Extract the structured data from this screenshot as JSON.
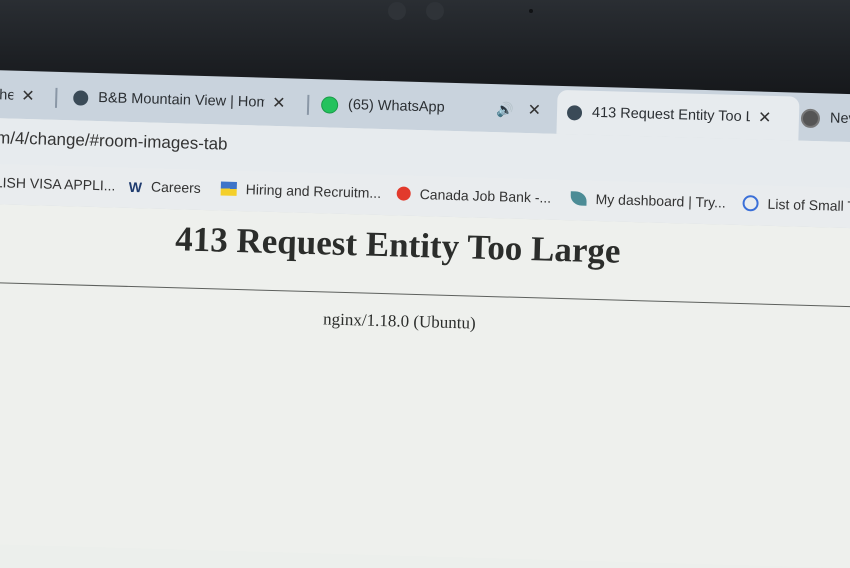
{
  "tabs": [
    {
      "title": "hea",
      "active": false,
      "icon": "none"
    },
    {
      "title": "B&B Mountain View | Hom",
      "active": false,
      "icon": "globe-icon"
    },
    {
      "title": "(65) WhatsApp",
      "active": false,
      "icon": "whatsapp-icon",
      "audio": true
    },
    {
      "title": "413 Request Entity Too Lar",
      "active": true,
      "icon": "globe-icon"
    },
    {
      "title": "Nev",
      "active": false,
      "icon": "chrome-icon"
    }
  ],
  "tab_close_glyph": "✕",
  "audio_glyph": "🔊",
  "address": {
    "url": "m/4/change/#room-images-tab"
  },
  "bookmarks": [
    {
      "label": "LISH VISA APPLI...",
      "icon": "none"
    },
    {
      "label": "Careers",
      "icon": "w-logo-icon",
      "icon_text": "W"
    },
    {
      "label": "Hiring and Recruitm...",
      "icon": "flag-icon"
    },
    {
      "label": "Canada Job Bank -...",
      "icon": "maple-leaf-icon"
    },
    {
      "label": "My dashboard | Try...",
      "icon": "leaf-icon"
    },
    {
      "label": "List of Small T",
      "icon": "link-icon"
    }
  ],
  "page": {
    "heading": "413 Request Entity Too Large",
    "server": "nginx/1.18.0 (Ubuntu)"
  },
  "colors": {
    "tabstrip": "#c9d3dd",
    "active_tab": "#e7ebee",
    "page_bg": "#eef0ed",
    "bezel": "#1d2024"
  }
}
